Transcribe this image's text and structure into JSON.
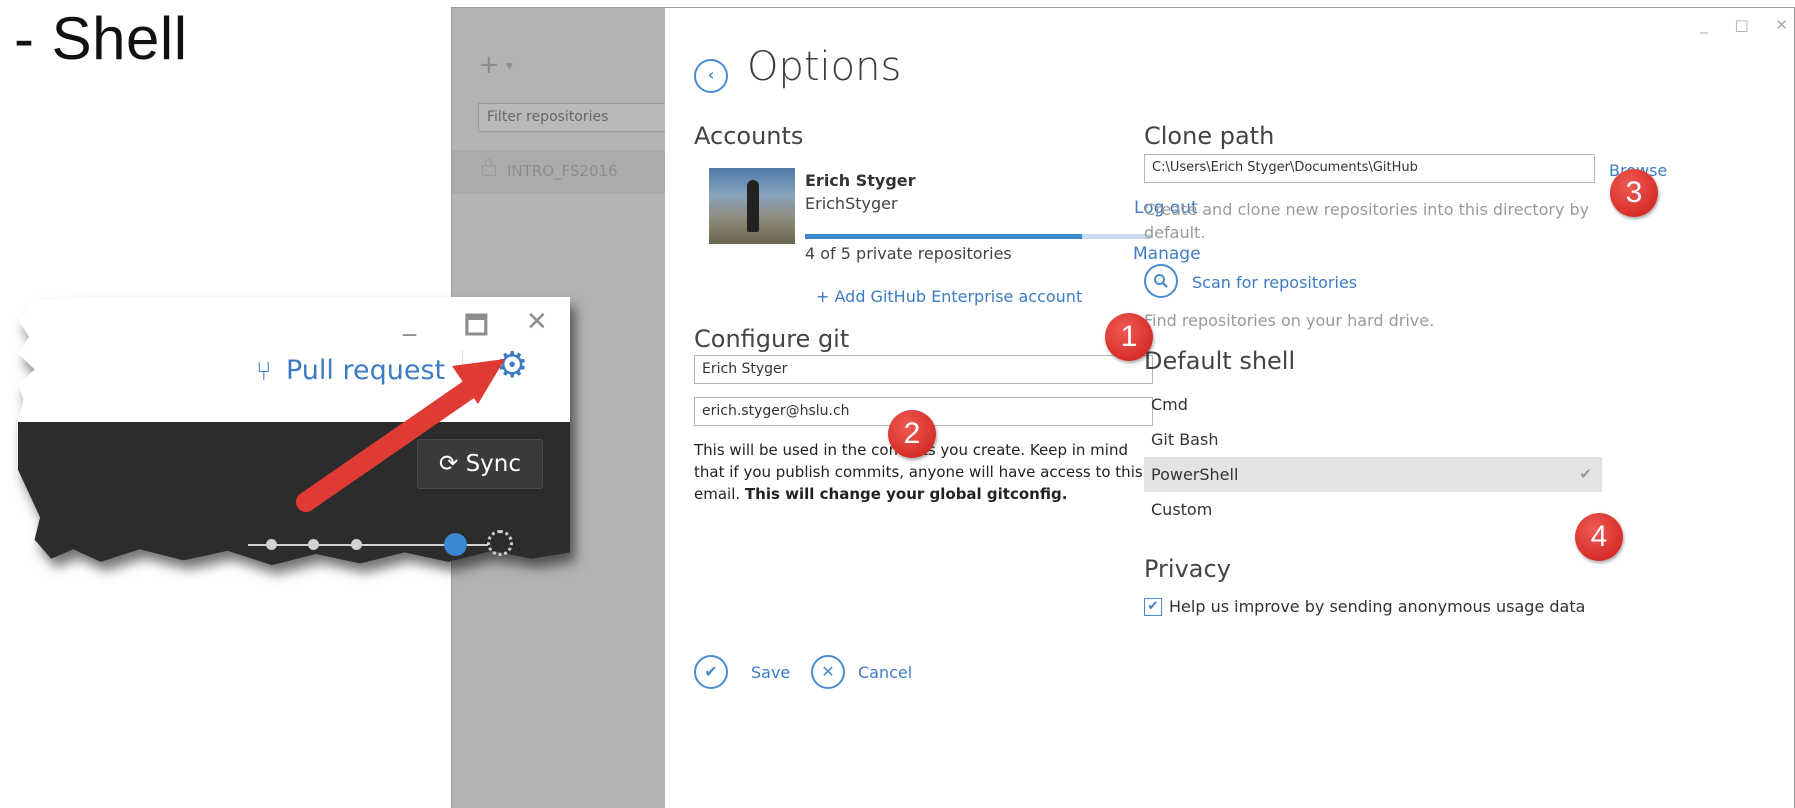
{
  "slide": {
    "title": "- Shell"
  },
  "app": {
    "left_pane": {
      "add_icon": "plus-icon",
      "add_symbol": "+",
      "filter_placeholder": "Filter repositories",
      "repositories": [
        {
          "name": "INTRO_FS2016",
          "icon": "lock-icon"
        }
      ]
    },
    "window_controls": {
      "minimize": "_",
      "maximize": "□",
      "close": "✕"
    },
    "options": {
      "back_symbol": "‹",
      "title": "Options",
      "accounts": {
        "heading": "Accounts",
        "user_name": "Erich Styger",
        "login": "ErichStyger",
        "logout_label": "Log out",
        "repos_used": 4,
        "repos_total": 5,
        "repo_quota_text": "4 of 5 private repositories",
        "manage_label": "Manage",
        "add_enterprise_label": "+ Add GitHub Enterprise account"
      },
      "configure_git": {
        "heading": "Configure git",
        "name_value": "Erich Styger",
        "email_value": "erich.styger@hslu.ch",
        "note": "This will be used in the commits you create. Keep in mind that if you publish commits, anyone will have access to this email.",
        "note_bold": "This will change your global gitconfig."
      },
      "clone_path": {
        "heading": "Clone path",
        "value": "C:\\Users\\Erich Styger\\Documents\\GitHub",
        "browse_label": "Browse",
        "description": "Create and clone new repositories into this directory by default.",
        "scan_label": "Scan for repositories",
        "scan_description": "Find repositories on your hard drive."
      },
      "default_shell": {
        "heading": "Default shell",
        "options": [
          "Cmd",
          "Git Bash",
          "PowerShell",
          "Custom"
        ],
        "selected": "PowerShell",
        "check_symbol": "✔"
      },
      "privacy": {
        "heading": "Privacy",
        "checkbox_label": "Help us improve by sending anonymous usage data",
        "checked": true,
        "check_symbol": "✔"
      },
      "footer": {
        "save_label": "Save",
        "cancel_label": "Cancel",
        "save_symbol": "✔",
        "cancel_symbol": "✕"
      }
    }
  },
  "callout": {
    "minimize": "_",
    "maximize": "🗖",
    "close": "✕",
    "pull_request_label": "Pull request",
    "pull_request_icon_symbol": "⑂",
    "gear_symbol": "⚙",
    "sync_label": "Sync",
    "sync_icon_symbol": "⟳"
  },
  "annotations": {
    "badge_1": "1",
    "badge_2": "2",
    "badge_3": "3",
    "badge_4": "4",
    "arrow_color": "#e03a35"
  },
  "colors": {
    "accent": "#3d7cc4",
    "sidebar": "#b3b3b3",
    "badge_red": "#d72e2a",
    "selected_row": "#e3e3e3"
  }
}
